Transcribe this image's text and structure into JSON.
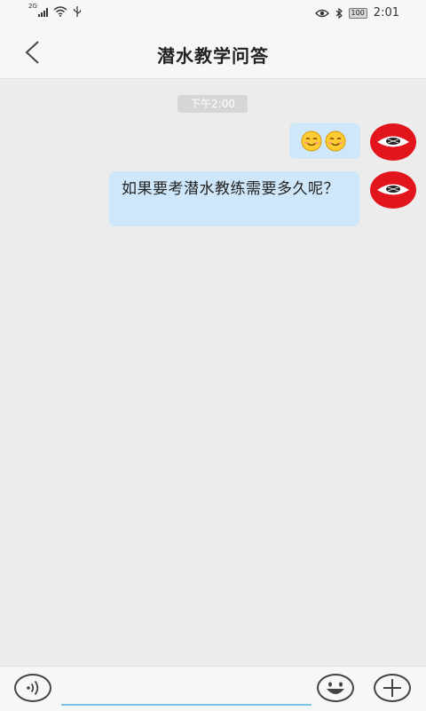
{
  "status_bar": {
    "network": "2G",
    "battery": "100",
    "time": "2:01",
    "icons": [
      "signal-icon",
      "wifi-icon",
      "usb-icon",
      "eye-icon",
      "bluetooth-icon",
      "battery-icon"
    ]
  },
  "header": {
    "title": "潜水教学问答",
    "back_icon": "chevron-left-icon"
  },
  "chat": {
    "timestamp": "下午2:00",
    "messages": [
      {
        "sender": "self",
        "type": "emoji",
        "content": [
          "smiling-face-emoji",
          "smiling-face-emoji"
        ]
      },
      {
        "sender": "self",
        "type": "text",
        "content": "如果要考潜水教练需要多久呢？"
      }
    ]
  },
  "input_bar": {
    "value": "",
    "placeholder": "",
    "accent_color": "#7bc4e6",
    "icons": [
      "voice-icon",
      "emoji-icon",
      "plus-icon"
    ]
  },
  "colors": {
    "background": "#ececec",
    "bubble": "#cfe7fa",
    "avatar": "#e2141c"
  }
}
